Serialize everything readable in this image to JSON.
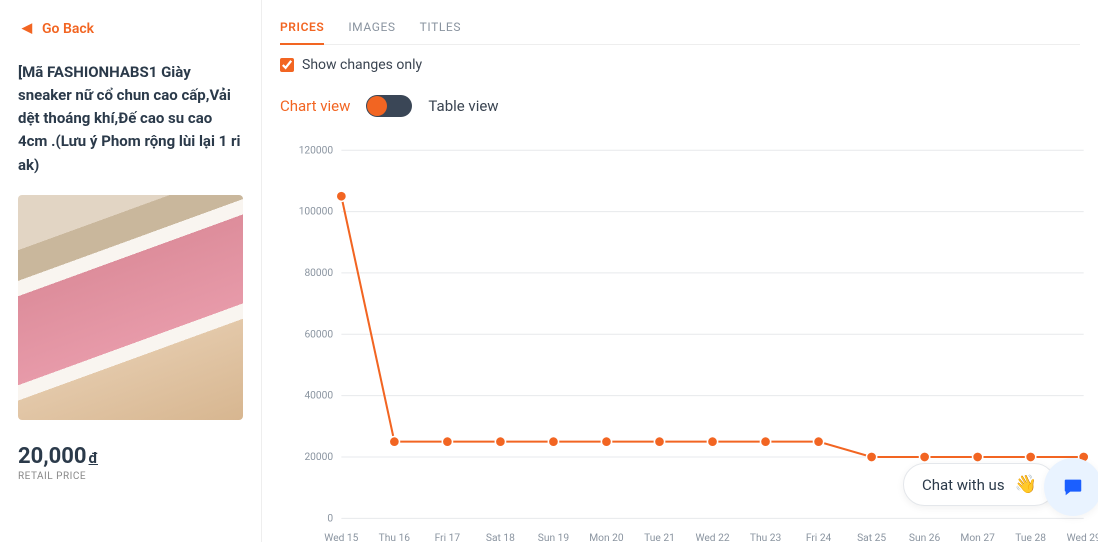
{
  "sidebar": {
    "go_back": "Go Back",
    "product_title": "[Mã FASHIONHABS1 Giày sneaker nữ cổ chun cao cấp,Vải dệt thoáng khí,Đế cao su cao 4cm .(Lưu ý Phom rộng lùi lại 1 ri ak)",
    "price_value": "20,000",
    "price_currency": "đ",
    "retail_label": "RETAIL PRICE"
  },
  "tabs": {
    "prices": "PRICES",
    "images": "IMAGES",
    "titles": "TITLES"
  },
  "controls": {
    "show_changes": "Show changes only",
    "chart_view": "Chart view",
    "table_view": "Table view"
  },
  "chat": {
    "label": "Chat with us"
  },
  "chart_data": {
    "type": "line",
    "ylabel": "",
    "xlabel": "",
    "ylim": [
      0,
      120000
    ],
    "yticks": [
      0,
      20000,
      40000,
      60000,
      80000,
      100000,
      120000
    ],
    "categories": [
      "Wed 15",
      "Thu 16",
      "Fri 17",
      "Sat 18",
      "Sun 19",
      "Mon 20",
      "Tue 21",
      "Wed 22",
      "Thu 23",
      "Fri 24",
      "Sat 25",
      "Sun 26",
      "Mon 27",
      "Tue 28",
      "Wed 29"
    ],
    "values": [
      105000,
      25000,
      25000,
      25000,
      25000,
      25000,
      25000,
      25000,
      25000,
      25000,
      20000,
      20000,
      20000,
      20000,
      20000
    ]
  }
}
